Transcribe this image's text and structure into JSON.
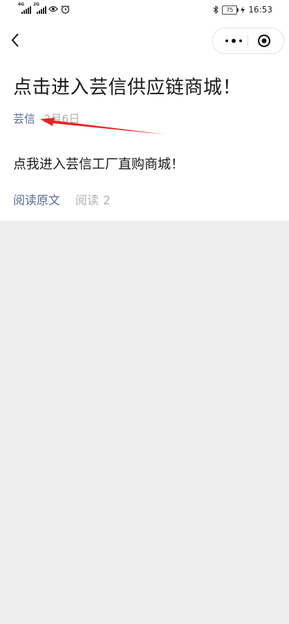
{
  "status_bar": {
    "sim1_tag": "4G",
    "sim2_tag": "2G",
    "battery": "75",
    "time": "16:53",
    "icons": [
      "signal-icon",
      "signal-icon",
      "eye-icon",
      "alarm-icon",
      "bluetooth-icon",
      "battery-icon",
      "charging-icon"
    ]
  },
  "nav": {
    "back_icon": "chevron-left-icon",
    "more_icon": "more-dots-icon",
    "close_icon": "target-circle-icon"
  },
  "article": {
    "title": "点击进入芸信供应链商城！",
    "author": "芸信",
    "date": "2月6日",
    "body": "点我进入芸信工厂直购商城！"
  },
  "footer": {
    "read_original": "阅读原文",
    "read_label": "阅读",
    "read_count": "2"
  },
  "colors": {
    "link_blue": "#576b95",
    "meta_grey": "#b2b2b2",
    "annotation_red": "#e8231f",
    "background": "#ededed"
  }
}
